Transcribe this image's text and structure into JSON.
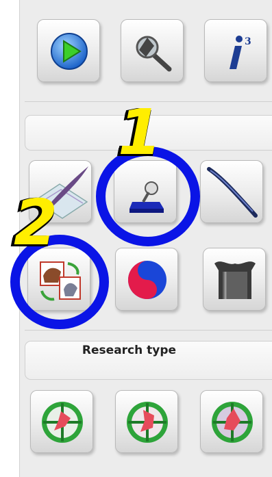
{
  "sections": {
    "research_type_title": "Research type"
  },
  "tools_row1": [
    {
      "name": "play",
      "icon": "play-icon"
    },
    {
      "name": "zoom",
      "icon": "magnifier-icon"
    },
    {
      "name": "info",
      "icon": "info-cubed-icon"
    }
  ],
  "tools_row2": [
    {
      "name": "draw",
      "icon": "quill-paper-icon"
    },
    {
      "name": "stamp",
      "icon": "stamp-tool-icon"
    },
    {
      "name": "brush",
      "icon": "brush-stroke-icon"
    }
  ],
  "tools_row3": [
    {
      "name": "swap-images",
      "icon": "swap-images-icon"
    },
    {
      "name": "yin-yang",
      "icon": "yin-yang-icon"
    },
    {
      "name": "funnel",
      "icon": "funnel-icon"
    }
  ],
  "research_row": [
    {
      "name": "research-1",
      "icon": "target-arrows-icon"
    },
    {
      "name": "research-2",
      "icon": "target-arrows-icon"
    },
    {
      "name": "research-3",
      "icon": "target-arrows-icon"
    }
  ],
  "annotations": {
    "label_1": "1",
    "label_2": "2",
    "circle_color": "#0a14e6",
    "number_color": "#ffee00"
  }
}
